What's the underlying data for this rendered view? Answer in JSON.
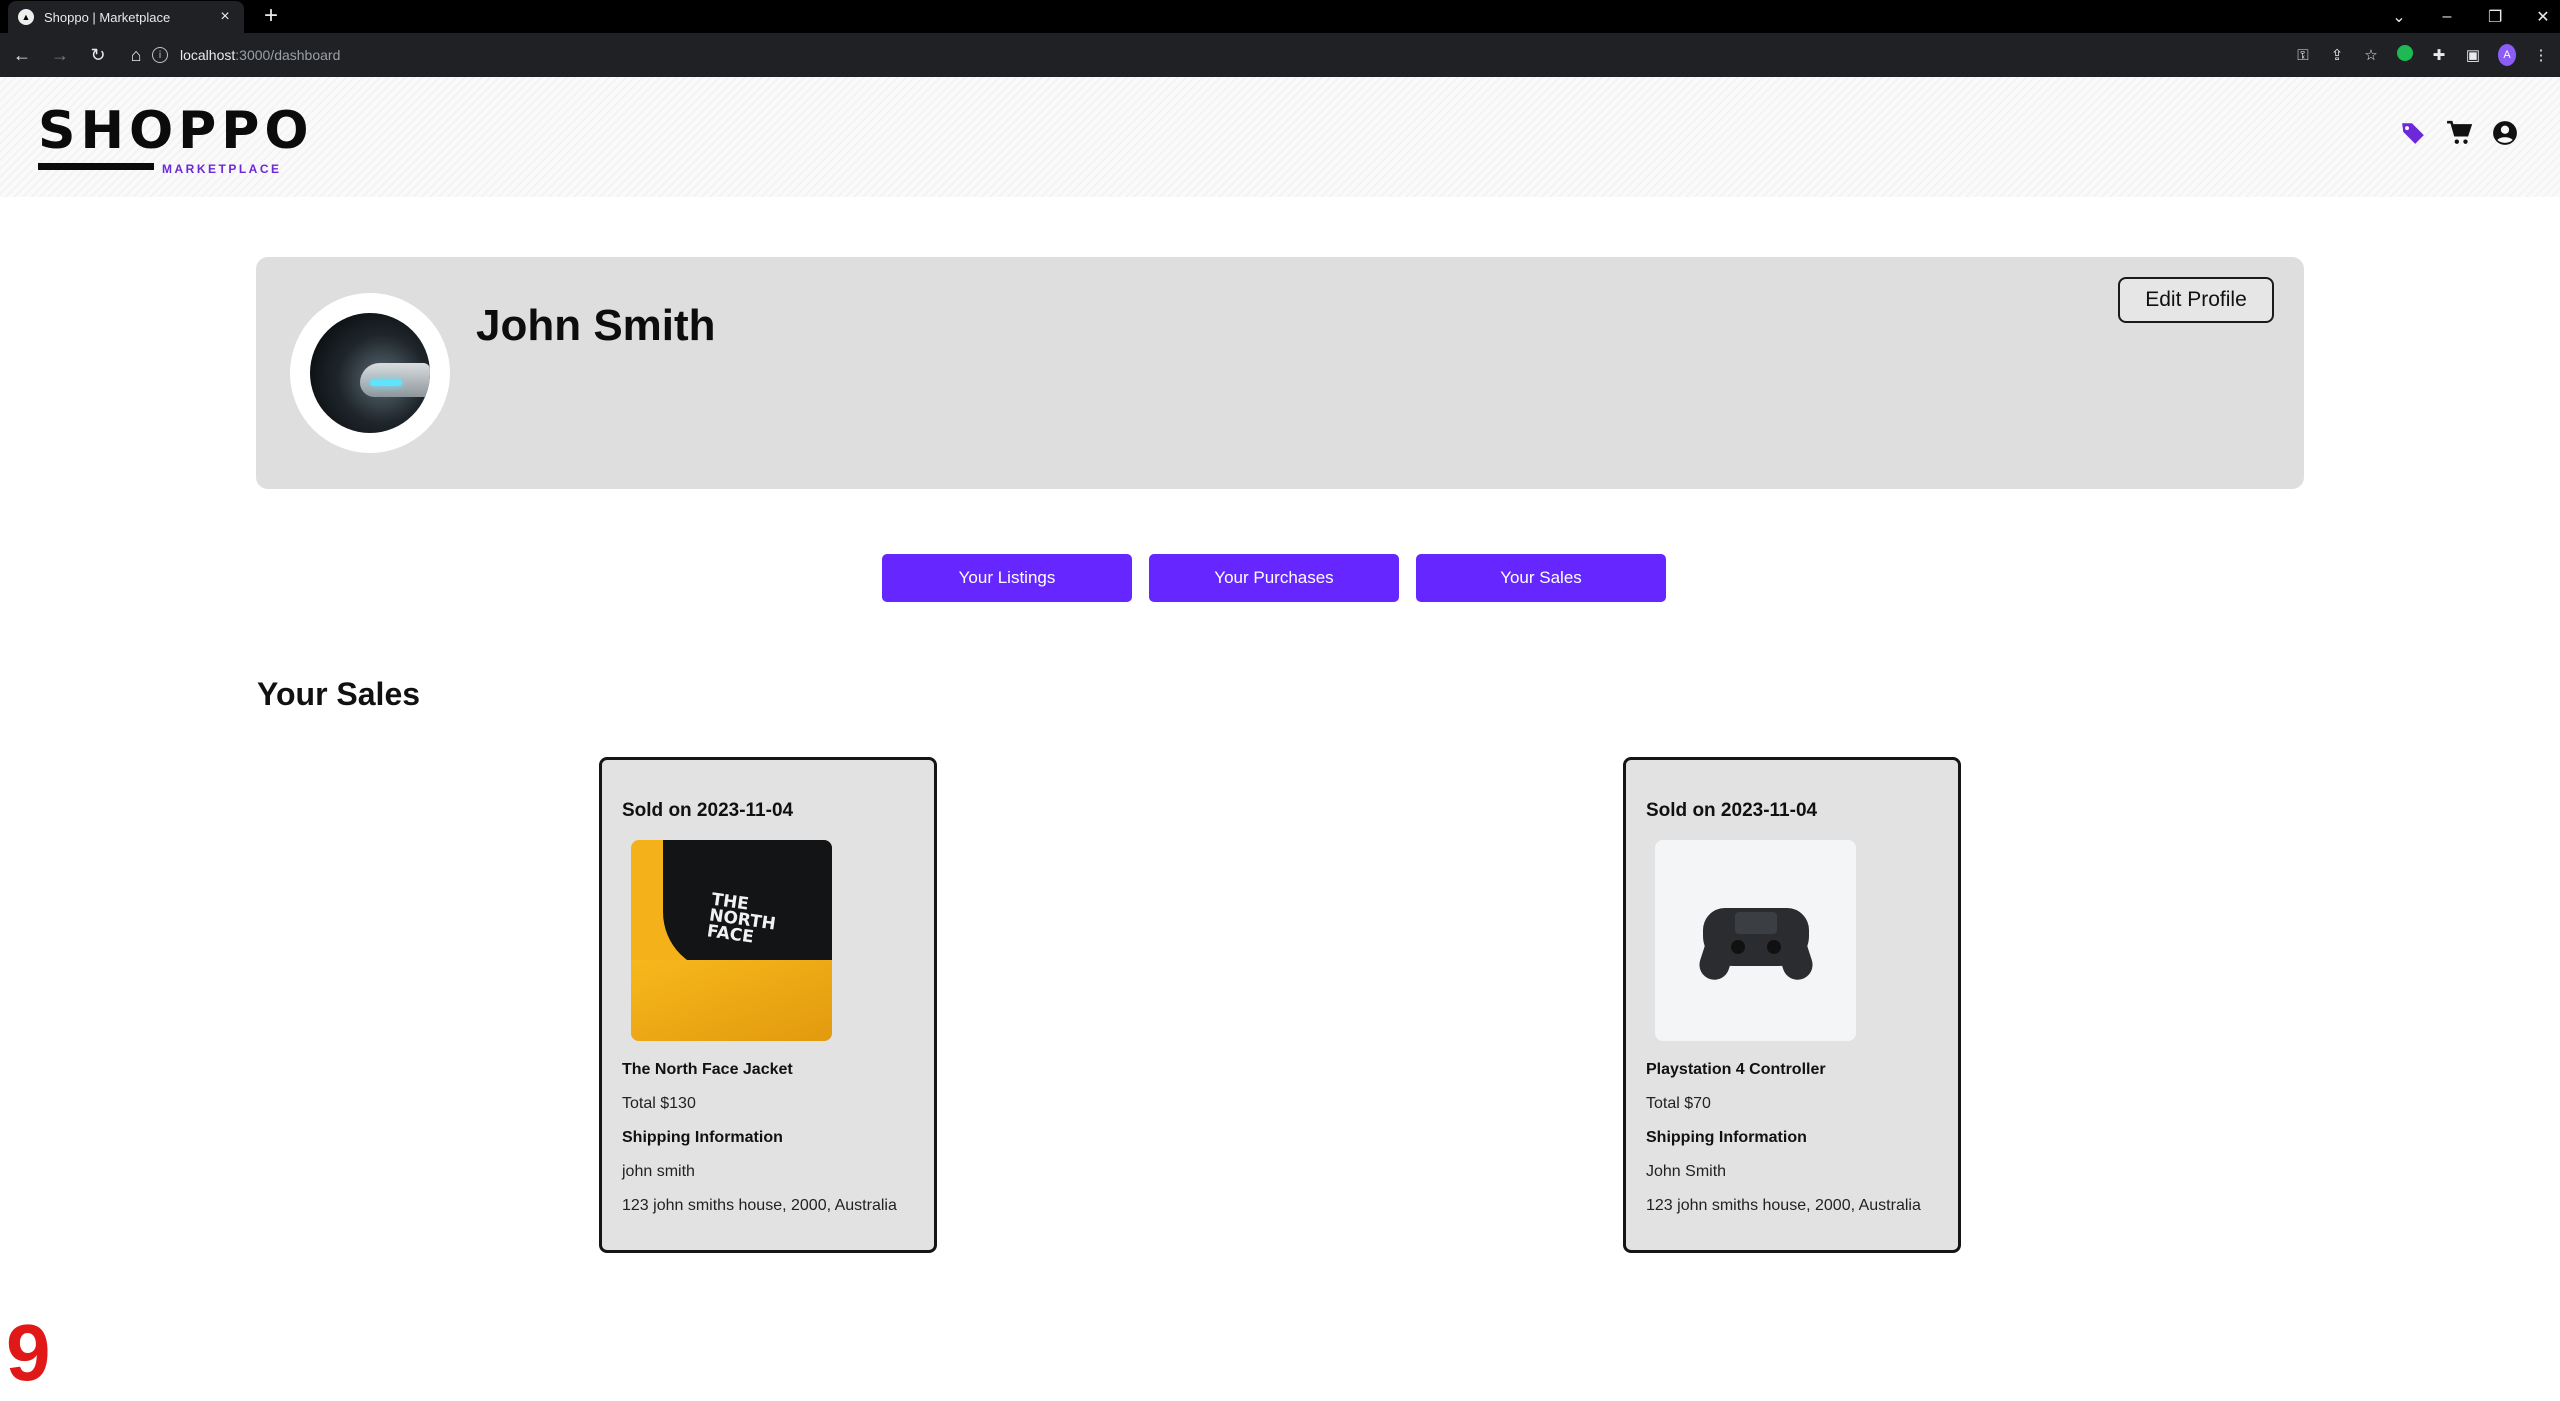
{
  "browser": {
    "tab_title": "Shoppo | Marketplace",
    "url_host": "localhost",
    "url_path": ":3000/dashboard",
    "profile_initial": "A"
  },
  "site": {
    "logo_text": "SHOPPO",
    "logo_sub": "MARKETPLACE",
    "accent_color": "#6526ff",
    "header_icons": [
      "tag-icon",
      "cart-icon",
      "account-icon"
    ]
  },
  "profile": {
    "name": "John Smith",
    "edit_label": "Edit Profile"
  },
  "tabs": [
    {
      "label": "Your Listings"
    },
    {
      "label": "Your Purchases"
    },
    {
      "label": "Your Sales"
    }
  ],
  "section_title": "Your Sales",
  "sales": [
    {
      "sold_on": "Sold on 2023-11-04",
      "item_name": "The North Face Jacket",
      "total": "Total $130",
      "shipping_heading": "Shipping Information",
      "ship_name": "john smith",
      "ship_address": "123 john smiths house, 2000, Australia",
      "logo_line1": "THE",
      "logo_line2": "NORTH",
      "logo_line3": "FACE"
    },
    {
      "sold_on": "Sold on 2023-11-04",
      "item_name": "Playstation 4 Controller",
      "total": "Total $70",
      "shipping_heading": "Shipping Information",
      "ship_name": "John Smith",
      "ship_address": "123 john smiths house, 2000, Australia"
    }
  ],
  "overlay_number": "9"
}
